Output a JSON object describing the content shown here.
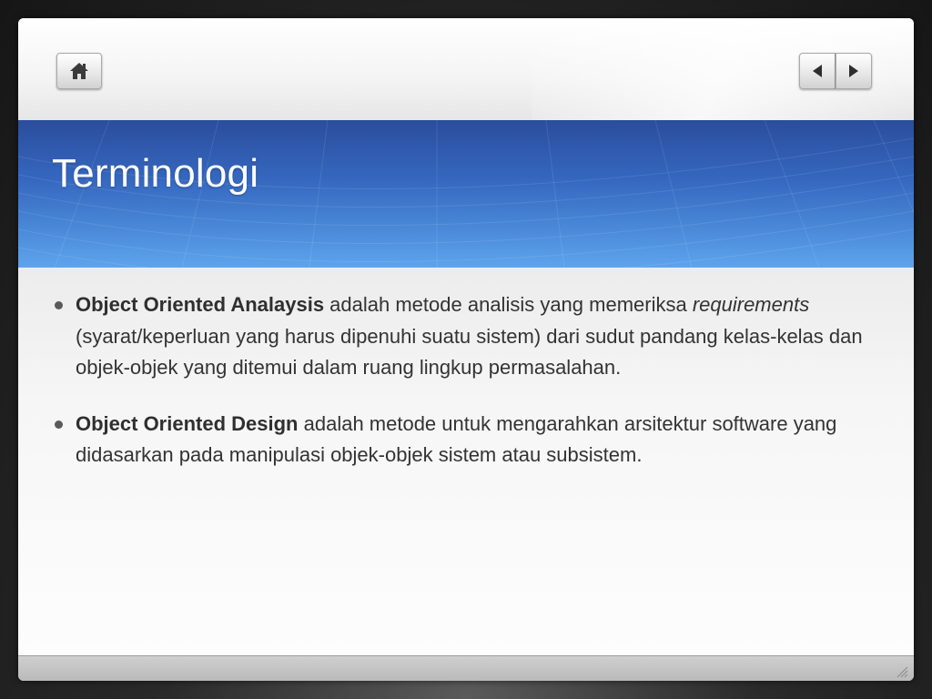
{
  "nav": {
    "home_icon": "home-icon",
    "prev_icon": "triangle-left-icon",
    "next_icon": "triangle-right-icon"
  },
  "slide": {
    "title": "Terminologi",
    "bullets": [
      {
        "term": "Object Oriented Analaysis",
        "text_before": " adalah metode analisis yang memeriksa ",
        "emphasis": "requirements",
        "text_after": " (syarat/keperluan yang harus dipenuhi suatu sistem) dari sudut pandang kelas-kelas dan objek-objek yang ditemui dalam ruang lingkup permasalahan."
      },
      {
        "term": "Object Oriented Design",
        "text_before": " adalah metode untuk mengarahkan arsitektur software yang didasarkan pada manipulasi objek-objek sistem atau subsistem."
      }
    ]
  },
  "colors": {
    "title_band": "#3567bf",
    "title_text": "#ffffff",
    "body_text": "#333333"
  }
}
